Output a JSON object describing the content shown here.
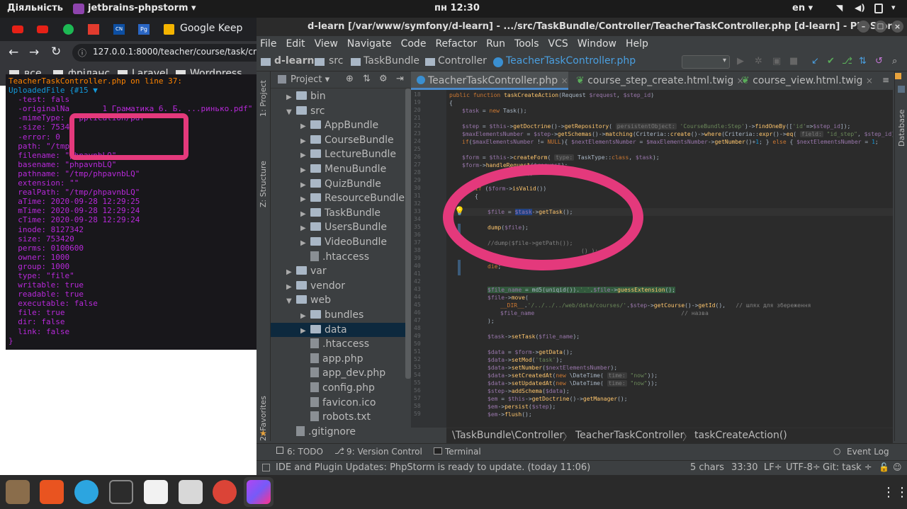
{
  "topbar": {
    "activities": "Діяльність",
    "app_name": "jetbrains-phpstorm",
    "clock": "пн 12:30",
    "lang": "en"
  },
  "browser": {
    "tab_title": "Google Keep",
    "url": "127.0.0.1:8000/teacher/course/task/cre",
    "bookmarks": [
      "все",
      "фріланс",
      "Laravel",
      "Wordpress"
    ]
  },
  "dump": {
    "header": "TeacherTaskController.php on line 37:",
    "lines": [
      "UploadedFile {#15 ▼",
      "  -test: fals",
      "  -originalNa       1 Граматика 6. Б. ...ринько.pdf\"",
      "  -mimeType:   pplication/pdf\"",
      "  -size: 7534",
      "  -error: 0",
      "  path: \"/tmp\"",
      "  filename: \"phpavnbLQ\"",
      "  basename: \"phpavnbLQ\"",
      "  pathname: \"/tmp/phpavnbLQ\"",
      "  extension: \"\"",
      "  realPath: \"/tmp/phpavnbLQ\"",
      "  aTime: 2020-09-28 12:29:25",
      "  mTime: 2020-09-28 12:29:24",
      "  cTime: 2020-09-28 12:29:24",
      "  inode: 8127342",
      "  size: 753420",
      "  perms: 0100600",
      "  owner: 1000",
      "  group: 1000",
      "  type: \"file\"",
      "  writable: true",
      "  readable: true",
      "  executable: false",
      "  file: true",
      "  dir: false",
      "  link: false",
      "}"
    ]
  },
  "ide": {
    "title": "d-learn [/var/www/symfony/d-learn] - .../src/TaskBundle/Controller/TeacherTaskController.php [d-learn] - PhpStorm",
    "menu": [
      "File",
      "Edit",
      "View",
      "Navigate",
      "Code",
      "Refactor",
      "Run",
      "Tools",
      "VCS",
      "Window",
      "Help"
    ],
    "nav": [
      "d-learn",
      "src",
      "TaskBundle",
      "Controller",
      "TeacherTaskController.php"
    ],
    "project_label": "Project",
    "side_tabs": [
      "1: Project",
      "Z: Structure",
      "2: Favorites"
    ],
    "right_tab": "Database",
    "tree": [
      {
        "label": "bin",
        "kind": "folder",
        "indent": 1,
        "arrow": "▶"
      },
      {
        "label": "src",
        "kind": "folder",
        "indent": 1,
        "arrow": "▼"
      },
      {
        "label": "AppBundle",
        "kind": "folder",
        "indent": 2,
        "arrow": "▶"
      },
      {
        "label": "CourseBundle",
        "kind": "folder",
        "indent": 2,
        "arrow": "▶"
      },
      {
        "label": "LectureBundle",
        "kind": "folder",
        "indent": 2,
        "arrow": "▶"
      },
      {
        "label": "MenuBundle",
        "kind": "folder",
        "indent": 2,
        "arrow": "▶"
      },
      {
        "label": "QuizBundle",
        "kind": "folder",
        "indent": 2,
        "arrow": "▶"
      },
      {
        "label": "ResourceBundle",
        "kind": "folder",
        "indent": 2,
        "arrow": "▶"
      },
      {
        "label": "TaskBundle",
        "kind": "folder",
        "indent": 2,
        "arrow": "▶"
      },
      {
        "label": "UsersBundle",
        "kind": "folder",
        "indent": 2,
        "arrow": "▶"
      },
      {
        "label": "VideoBundle",
        "kind": "folder",
        "indent": 2,
        "arrow": "▶"
      },
      {
        "label": ".htaccess",
        "kind": "file",
        "indent": 2,
        "arrow": ""
      },
      {
        "label": "var",
        "kind": "folder",
        "indent": 1,
        "arrow": "▶"
      },
      {
        "label": "vendor",
        "kind": "folder",
        "indent": 1,
        "arrow": "▶"
      },
      {
        "label": "web",
        "kind": "folder",
        "indent": 1,
        "arrow": "▼"
      },
      {
        "label": "bundles",
        "kind": "folder",
        "indent": 2,
        "arrow": "▶"
      },
      {
        "label": "data",
        "kind": "folder",
        "indent": 2,
        "arrow": "▶",
        "selected": true
      },
      {
        "label": ".htaccess",
        "kind": "file",
        "indent": 2,
        "arrow": ""
      },
      {
        "label": "app.php",
        "kind": "file",
        "indent": 2,
        "arrow": ""
      },
      {
        "label": "app_dev.php",
        "kind": "file",
        "indent": 2,
        "arrow": ""
      },
      {
        "label": "config.php",
        "kind": "file",
        "indent": 2,
        "arrow": ""
      },
      {
        "label": "favicon.ico",
        "kind": "file",
        "indent": 2,
        "arrow": ""
      },
      {
        "label": "robots.txt",
        "kind": "file",
        "indent": 2,
        "arrow": ""
      },
      {
        "label": ".gitignore",
        "kind": "file",
        "indent": 1,
        "arrow": ""
      }
    ],
    "tabs": [
      "TeacherTaskController.php",
      "course_step_create.html.twig",
      "course_view.html.twig"
    ],
    "line_numbers": [
      "18",
      "19",
      "20",
      "21",
      "22",
      "23",
      "24",
      "25",
      "26",
      "27",
      "28",
      "29",
      "30",
      "31",
      "32",
      "33",
      "34",
      "35",
      "36",
      "37",
      "38",
      "39",
      "40",
      "41",
      "42",
      "43",
      "44",
      "45",
      "46",
      "47",
      "48",
      "49",
      "50",
      "51",
      "52",
      "53",
      "54",
      "55",
      "56",
      "57",
      "58",
      "59"
    ],
    "breadcrumb": [
      "\\TaskBundle\\Controller",
      "TeacherTaskController",
      "taskCreateAction()"
    ],
    "tool_tabs": [
      "6: TODO",
      "9: Version Control",
      "Terminal",
      "Event Log"
    ],
    "status": {
      "message": "IDE and Plugin Updates: PhpStorm is ready to update. (today 11:06)",
      "chars": "5 chars",
      "pos": "33:30",
      "lf": "LF÷",
      "enc": "UTF-8÷",
      "git": "Git: task ÷"
    }
  },
  "colors": {
    "annotation": "#e4397c",
    "accent": "#4a88c7"
  }
}
